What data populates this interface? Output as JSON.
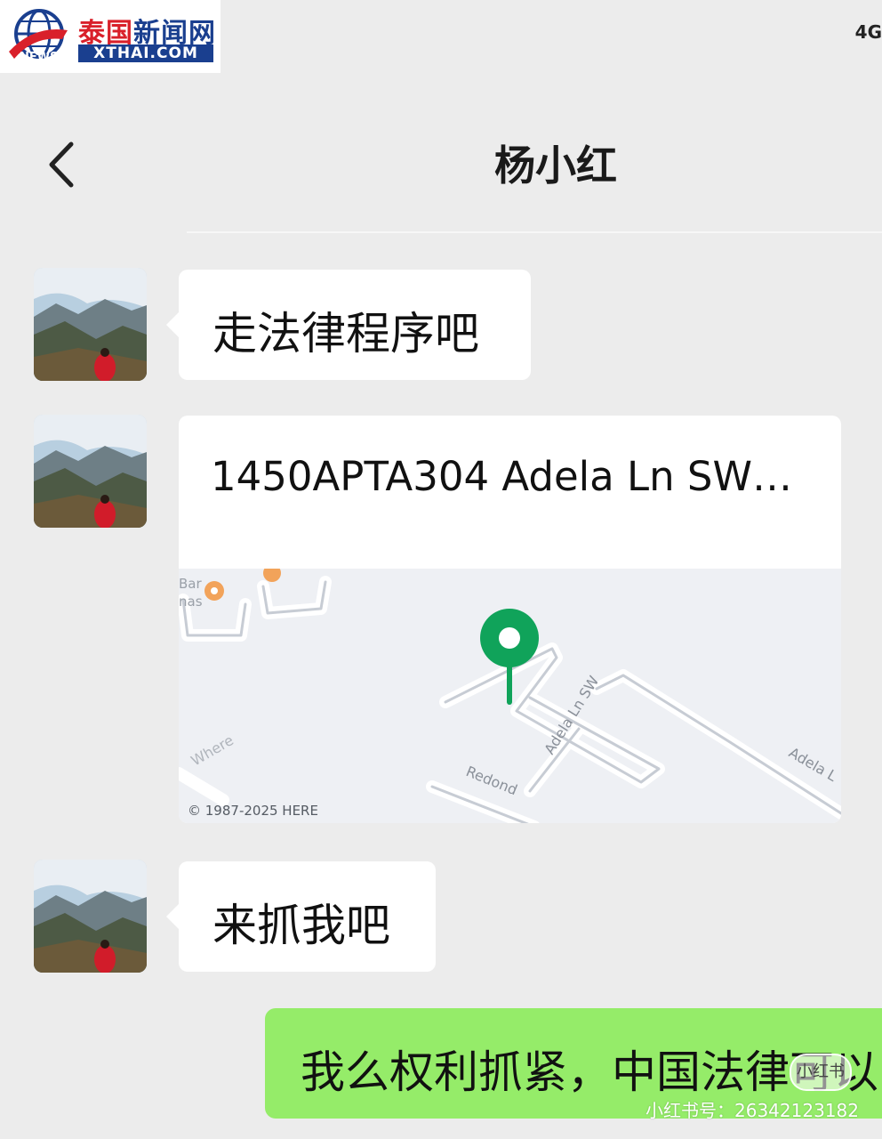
{
  "watermark_logo": {
    "cn_first": "泰国",
    "cn_rest": "新闻网",
    "en": "XTHAI.COM",
    "news": "NEWS"
  },
  "status_bar": {
    "network": "4G"
  },
  "header": {
    "title": "杨小红",
    "back_icon": "chevron-left-icon"
  },
  "messages": [
    {
      "type": "text",
      "side": "left",
      "text": "走法律程序吧"
    },
    {
      "type": "location",
      "side": "left",
      "title": "1450APTA304 Adela Ln SW…",
      "map": {
        "credit": "© 1987-2025 HERE",
        "street_label_1": "Adela Ln SW",
        "street_label_2": "Adela L",
        "street_label_3": "Redond",
        "poi_label_1": "Bar",
        "poi_label_2": "nas",
        "corner_label": "Where",
        "pin_color": "#10a35a"
      }
    },
    {
      "type": "text",
      "side": "left",
      "text": "来抓我吧"
    },
    {
      "type": "text",
      "side": "right",
      "text": "我么权利抓紧，中国法律可以"
    }
  ],
  "overlay": {
    "platform_id": "小红书号：26342123182",
    "platform_badge": "小红书"
  },
  "colors": {
    "chat_bg": "#ececec",
    "bubble_in": "#ffffff",
    "bubble_out": "#95ec69"
  }
}
